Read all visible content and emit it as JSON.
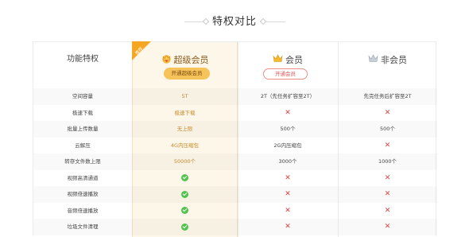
{
  "title": "特权对比",
  "header": {
    "feature_label": "功能特权",
    "super": {
      "name": "超级会员",
      "button": "开通超级会员",
      "ribbon": "推荐"
    },
    "vip": {
      "name": "会员",
      "button": "开通会员"
    },
    "non": {
      "name": "非会员"
    }
  },
  "colors": {
    "super_bg": "#fdf7ea",
    "gold": "#f6c25a",
    "red": "#e23f3f",
    "green": "#52c34e"
  },
  "rows": [
    {
      "label": "空间容量",
      "super": "5T",
      "vip": "2T（先任务扩容至2T）",
      "non": "先完任务后扩容至2T"
    },
    {
      "label": "极速下载",
      "super": "极速下载",
      "vip": "cross-icon",
      "non": "cross-icon"
    },
    {
      "label": "批量上传数量",
      "super": "无上限",
      "vip": "500个",
      "non": "500个"
    },
    {
      "label": "云解压",
      "super": "4G内压缩包",
      "vip": "2G内压缩包",
      "non": "cross-icon"
    },
    {
      "label": "转存文件数上限",
      "super": "50000个",
      "vip": "3000个",
      "non": "1000个"
    },
    {
      "label": "视频高清通道",
      "super": "check-icon",
      "vip": "cross-icon",
      "non": "cross-icon"
    },
    {
      "label": "视频倍速播放",
      "super": "check-icon",
      "vip": "cross-icon",
      "non": "cross-icon"
    },
    {
      "label": "音频倍速播放",
      "super": "check-icon",
      "vip": "cross-icon",
      "non": "cross-icon"
    },
    {
      "label": "垃圾文件清理",
      "super": "check-icon",
      "vip": "cross-icon",
      "non": "cross-icon"
    }
  ]
}
